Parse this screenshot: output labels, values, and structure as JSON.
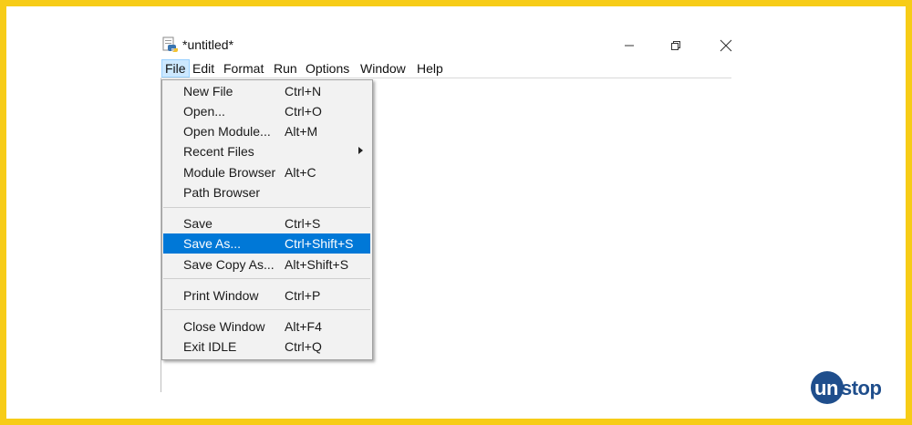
{
  "window": {
    "title": "*untitled*",
    "icon": "python-idle-icon",
    "controls": [
      "minimize-icon",
      "restore-icon",
      "close-icon"
    ]
  },
  "menubar": {
    "items": [
      {
        "label": "File",
        "active": true
      },
      {
        "label": "Edit"
      },
      {
        "label": "Format"
      },
      {
        "label": "Run"
      },
      {
        "label": "Options"
      },
      {
        "label": "Window"
      },
      {
        "label": "Help"
      }
    ]
  },
  "file_menu": {
    "groups": [
      [
        {
          "label": "New File",
          "shortcut": "Ctrl+N"
        },
        {
          "label": "Open...",
          "shortcut": "Ctrl+O"
        },
        {
          "label": "Open Module...",
          "shortcut": "Alt+M"
        },
        {
          "label": "Recent Files",
          "shortcut": "",
          "submenu": true
        },
        {
          "label": "Module Browser",
          "shortcut": "Alt+C"
        },
        {
          "label": "Path Browser",
          "shortcut": ""
        }
      ],
      [
        {
          "label": "Save",
          "shortcut": "Ctrl+S"
        },
        {
          "label": "Save As...",
          "shortcut": "Ctrl+Shift+S",
          "highlighted": true
        },
        {
          "label": "Save Copy As...",
          "shortcut": "Alt+Shift+S"
        }
      ],
      [
        {
          "label": "Print Window",
          "shortcut": "Ctrl+P"
        }
      ],
      [
        {
          "label": "Close Window",
          "shortcut": "Alt+F4"
        },
        {
          "label": "Exit IDLE",
          "shortcut": "Ctrl+Q"
        }
      ]
    ]
  },
  "logo": {
    "part1": "un",
    "part2": "stop"
  },
  "colors": {
    "frame": "#f7cc17",
    "highlight": "#0078d7",
    "active_menu": "#cce8ff",
    "logo": "#1f4e8c"
  }
}
